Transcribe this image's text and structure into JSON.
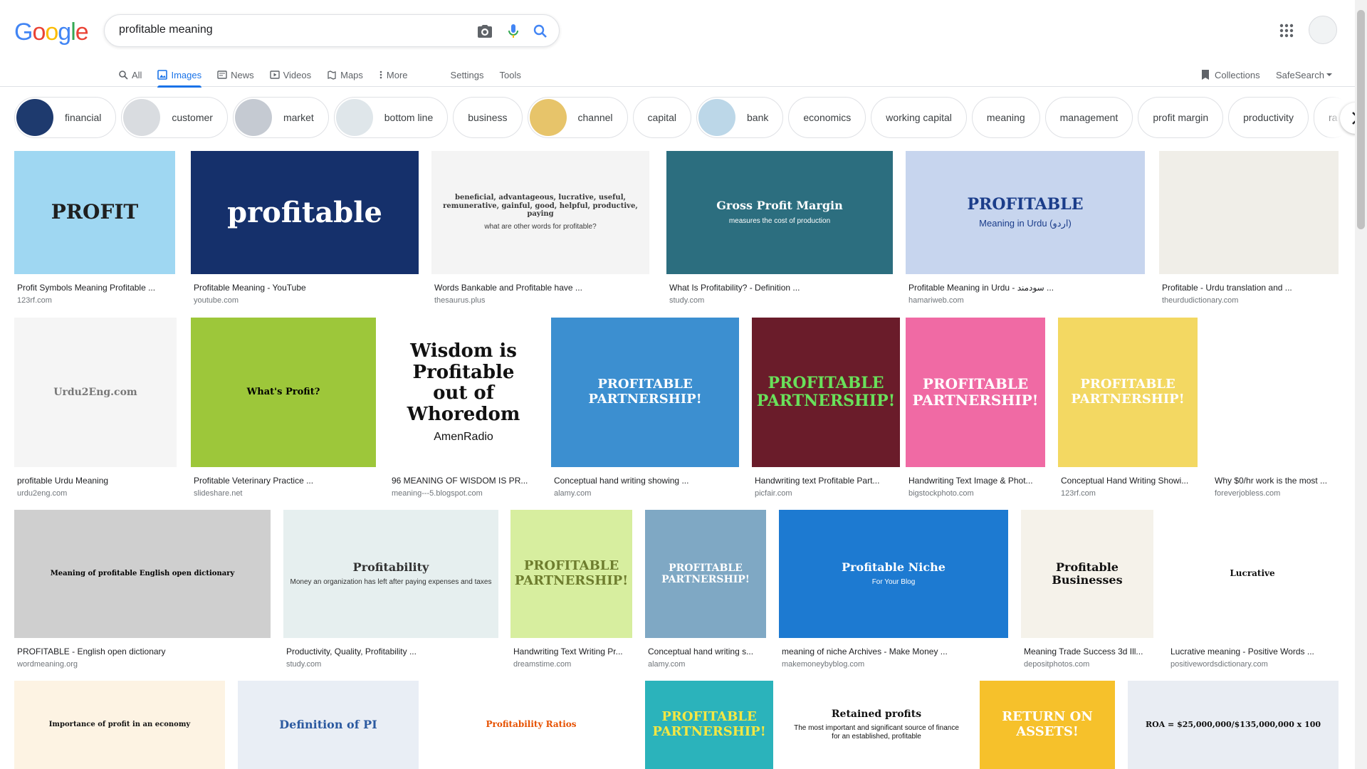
{
  "logo": {
    "letters": [
      "G",
      "o",
      "o",
      "g",
      "l",
      "e"
    ],
    "colors": [
      "#4285F4",
      "#EA4335",
      "#FBBC05",
      "#4285F4",
      "#34A853",
      "#EA4335"
    ]
  },
  "search": {
    "value": "profitable meaning"
  },
  "tabs": [
    {
      "label": "All",
      "icon": "search-icon"
    },
    {
      "label": "Images",
      "icon": "image-icon",
      "active": true
    },
    {
      "label": "News",
      "icon": "news-icon"
    },
    {
      "label": "Videos",
      "icon": "video-icon"
    },
    {
      "label": "Maps",
      "icon": "map-icon"
    },
    {
      "label": "More",
      "icon": "more-vert-icon"
    }
  ],
  "tools": {
    "settings": "Settings",
    "tools": "Tools"
  },
  "right": {
    "collections": "Collections",
    "safesearch": "SafeSearch"
  },
  "chips": [
    "financial",
    "customer",
    "market",
    "bottom line",
    "business",
    "channel",
    "capital",
    "bank",
    "economics",
    "working capital",
    "meaning",
    "management",
    "profit margin",
    "productivity",
    "ra"
  ],
  "results": {
    "row1": [
      {
        "title": "Profit Symbols Meaning Profitable ...",
        "source": "123rf.com",
        "img_text": "PROFIT"
      },
      {
        "title": "Profitable Meaning - YouTube",
        "source": "youtube.com",
        "img_text": "profitable"
      },
      {
        "title": "Words Bankable and Profitable have ...",
        "source": "thesaurus.plus",
        "img_text": "beneficial, advantageous, lucrative, useful, remunerative, gainful, good, helpful, productive, paying",
        "img_sub": "what are other words for profitable?"
      },
      {
        "title": "What Is Profitability? - Definition ...",
        "source": "study.com",
        "img_text": "Gross Profit Margin",
        "img_sub": "measures the cost of production"
      },
      {
        "title": "Profitable Meaning in Urdu - سودمند ...",
        "source": "hamariweb.com",
        "img_text": "PROFITABLE",
        "img_sub": "Meaning in Urdu (اردو)"
      },
      {
        "title": "Profitable - Urdu translation and ...",
        "source": "theurdudictionary.com"
      }
    ],
    "row2": [
      {
        "title": "profitable Urdu Meaning",
        "source": "urdu2eng.com",
        "img_text": "Urdu2Eng.com"
      },
      {
        "title": "Profitable Veterinary Practice ...",
        "source": "slideshare.net",
        "img_text": "What's Profit?"
      },
      {
        "title": "96 MEANING OF WISDOM IS PR...",
        "source": "meaning---5.blogspot.com",
        "img_text": "Wisdom is Profitable out of Whoredom",
        "img_sub": "AmenRadio"
      },
      {
        "title": "Conceptual hand writing showing ...",
        "source": "alamy.com",
        "img_text": "PROFITABLE PARTNERSHIP!"
      },
      {
        "title": "Handwriting text Profitable Part...",
        "source": "picfair.com",
        "img_text": "PROFITABLE PARTNERSHIP!"
      },
      {
        "title": "Handwriting Text Image & Phot...",
        "source": "bigstockphoto.com",
        "img_text": "PROFITABLE PARTNERSHIP!"
      },
      {
        "title": "Conceptual Hand Writing Showi...",
        "source": "123rf.com",
        "img_text": "PROFITABLE PARTNERSHIP!"
      },
      {
        "title": "Why $0/hr work is the most ...",
        "source": "foreverjobless.com"
      }
    ],
    "row3": [
      {
        "title": "PROFITABLE - English open dictionary",
        "source": "wordmeaning.org",
        "img_text": "Meaning of profitable English open dictionary"
      },
      {
        "title": "Productivity, Quality, Profitability ...",
        "source": "study.com",
        "img_text": "Profitability",
        "img_sub": "Money an organization has left after paying expenses and taxes"
      },
      {
        "title": "Handwriting Text Writing Pr...",
        "source": "dreamstime.com",
        "img_text": "PROFITABLE PARTNERSHIP!"
      },
      {
        "title": "Conceptual hand writing s...",
        "source": "alamy.com",
        "img_text": "PROFITABLE PARTNERSHIP!"
      },
      {
        "title": "meaning of niche Archives - Make Money ...",
        "source": "makemoneybyblog.com",
        "img_text": "Profitable Niche",
        "img_sub": "For Your Blog"
      },
      {
        "title": "Meaning Trade Success 3d Ill...",
        "source": "depositphotos.com",
        "img_text": "Profitable Businesses"
      },
      {
        "title": "Lucrative meaning - Positive Words ...",
        "source": "positivewordsdictionary.com",
        "img_text": "Lucrative"
      }
    ],
    "row4": [
      {
        "img_text": "Importance of profit in an economy"
      },
      {
        "img_text": "Definition of PI"
      },
      {
        "img_text": "Profitability Ratios"
      },
      {
        "img_text": "PROFITABLE PARTNERSHIP!"
      },
      {
        "img_text": "Retained profits",
        "img_sub": "The most important and significant source of finance for an established, profitable"
      },
      {
        "img_text": "RETURN ON ASSETS!"
      },
      {
        "img_text": "ROA = $25,000,000/$135,000,000 x 100"
      }
    ]
  }
}
